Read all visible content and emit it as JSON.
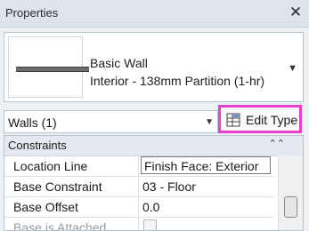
{
  "panel": {
    "title": "Properties",
    "close_icon": "close-icon"
  },
  "type_selector": {
    "family": "Basic Wall",
    "type": "Interior - 138mm Partition (1-hr)"
  },
  "filter": {
    "label": "Walls (1)"
  },
  "edit_type": {
    "label": "Edit Type",
    "icon": "edit-type-icon",
    "highlight_color": "#e83fcf"
  },
  "section": {
    "title": "Constraints"
  },
  "properties": [
    {
      "name": "Location Line",
      "value": "Finish Face: Exterior"
    },
    {
      "name": "Base Constraint",
      "value": "03 - Floor"
    },
    {
      "name": "Base Offset",
      "value": "0.0"
    },
    {
      "name": "Base is Attached",
      "value": ""
    }
  ]
}
